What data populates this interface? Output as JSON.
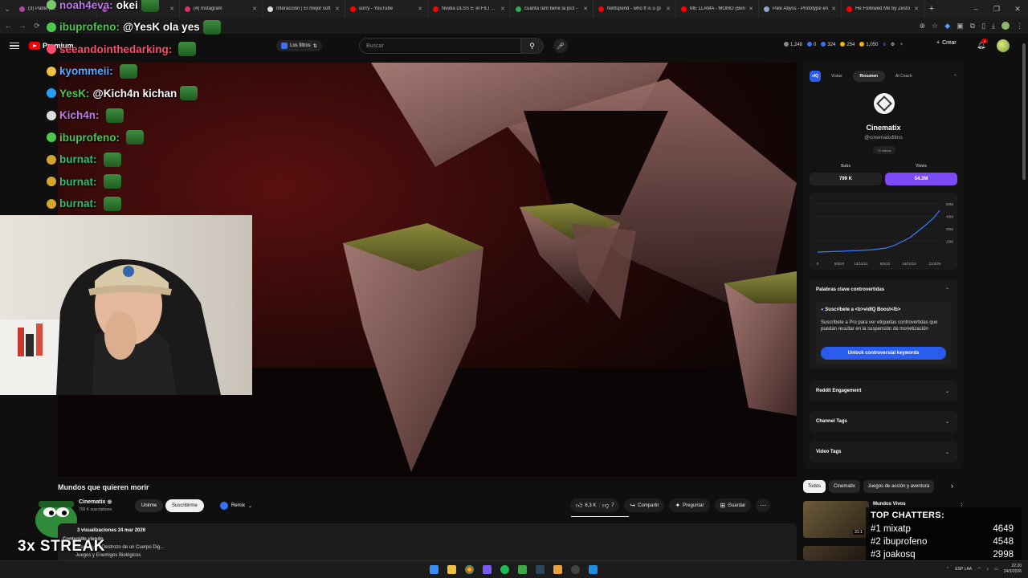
{
  "browser": {
    "tabs": [
      {
        "title": "(3) Pablo | ...",
        "color": "#a64ca6"
      },
      {
        "title": "",
        "color": "#a64ca6"
      },
      {
        "title": "(4) Instagram",
        "color": "#d6336c"
      },
      {
        "title": "Interacción | El mejor soft",
        "color": "#dddddd"
      },
      {
        "title": "sorry - YouTube",
        "color": "#ff0000"
      },
      {
        "title": "Nvidia DLSS 5: el FILTRO",
        "color": "#ff0000"
      },
      {
        "title": "cuanta ram tiene la ps3 -",
        "color": "#34a853"
      },
      {
        "title": "Nettspend - who tf is u (p",
        "color": "#ff0000"
      },
      {
        "title": "ME LLAMA - MOMO (Ben",
        "color": "#ff0000"
      },
      {
        "title": "Pale Abyss - Prototype en",
        "color": "#88aacc"
      },
      {
        "title": "He Followed Me by Zesto",
        "color": "#ff0000"
      }
    ],
    "new_tab": "+",
    "window_controls": [
      "–",
      "❐",
      "✕"
    ]
  },
  "header": {
    "logo_text": "Premium",
    "filters_label": "Los filtros",
    "search_placeholder": "Buscar",
    "stats": [
      "1,248",
      "0",
      "324",
      "254",
      "1,050"
    ],
    "create_label": "Crear",
    "notif_count": "3"
  },
  "chat": [
    {
      "user": "noah4eva:",
      "msg": "okei",
      "color": "#c07ae8",
      "badge": "#7bc96f"
    },
    {
      "user": "ibuprofeno:",
      "msg": "@YesK ola yes",
      "color": "#4cc94c",
      "badge": "#4cc94c"
    },
    {
      "user": "seeandointhedarking:",
      "msg": "",
      "color": "#ff4d6d",
      "badge": "#ff4d6d"
    },
    {
      "user": "kyommeii:",
      "msg": "",
      "color": "#5aa9ff",
      "badge": "#f0c040"
    },
    {
      "user": "YesK:",
      "msg": "@Kich4n kichan",
      "color": "#4cc94c",
      "badge": "#2a9df4"
    },
    {
      "user": "Kich4n:",
      "msg": "",
      "color": "#c07ae8",
      "badge": "#dddddd"
    },
    {
      "user": "ibuprofeno:",
      "msg": "",
      "color": "#4cc94c",
      "badge": "#4cc94c"
    },
    {
      "user": "burnat:",
      "msg": "",
      "color": "#2fbf71",
      "badge": "#d4a62a"
    },
    {
      "user": "burnat:",
      "msg": "",
      "color": "#2fbf71",
      "badge": "#d4a62a"
    },
    {
      "user": "burnat:",
      "msg": "",
      "color": "#2fbf71",
      "badge": "#d4a62a"
    }
  ],
  "video": {
    "title": "Mundos que quieren morir",
    "channel": "Cinematix",
    "subs": "799 K suscriptores",
    "join_label": "Unirme",
    "subscribe_label": "Suscribirme",
    "remix_label": "Remix",
    "likes": "6,3 K",
    "dislikes": "7",
    "share_label": "Compartir",
    "ask_label": "Preguntar",
    "save_label": "Guardar",
    "views_date": "3 visualizaciones  24 mar 2026",
    "desc_line1": "Contenido viendo",
    "desc_line2": "Juegos y El Destrozo de un Cuerpo Dig...",
    "desc_line3": "Juegos y Enemigos Biológicos"
  },
  "streak": "3x STREAK",
  "vidiq": {
    "logo": "vIQ",
    "tabs": [
      "Vistas",
      "Resumen",
      "AI Coach"
    ],
    "active_tab": 1,
    "channel_name": "Cinematix",
    "handle": "@cinematixfilms",
    "videos": "72 videos",
    "subs_label": "Subs",
    "subs_value": "799 K",
    "views_label": "Views",
    "views_value": "54.3M",
    "graph_y_ticks": [
      "60M",
      "45M",
      "30M",
      "15M"
    ],
    "graph_x_ticks": [
      "0",
      "5/6/20",
      "13/12/21",
      "8/5/23",
      "16/10/24",
      "21/3/26"
    ],
    "graph_color": "#3b7bff",
    "kw_section": "Palabras clave controvertidas",
    "kw_title": "Suscríbete a <b>vidIQ Boost</b>",
    "kw_text": "Suscríbete a Pro para ver etiquetas controvertidas que puedan resultar en la suspensión de monetización",
    "kw_button": "Unlock controversial keywords",
    "sections": [
      "Reddit Engagement",
      "Channel Tags",
      "Video Tags"
    ]
  },
  "chips": [
    "Todos",
    "Cinematix",
    "Juegos de acción y aventura"
  ],
  "recommendation": {
    "title": "Mundos Vivos",
    "duration": "31:1"
  },
  "top_chatters": {
    "title": "TOP CHATTERS:",
    "rows": [
      {
        "rank": "#1",
        "name": "mixatp",
        "score": "4649"
      },
      {
        "rank": "#2",
        "name": "ibuprofeno",
        "score": "4548"
      },
      {
        "rank": "#3",
        "name": "joakosq",
        "score": "2998"
      }
    ]
  },
  "taskbar": {
    "lang": "ESP LAA",
    "time": "22:20",
    "date": "24/3/2026"
  }
}
